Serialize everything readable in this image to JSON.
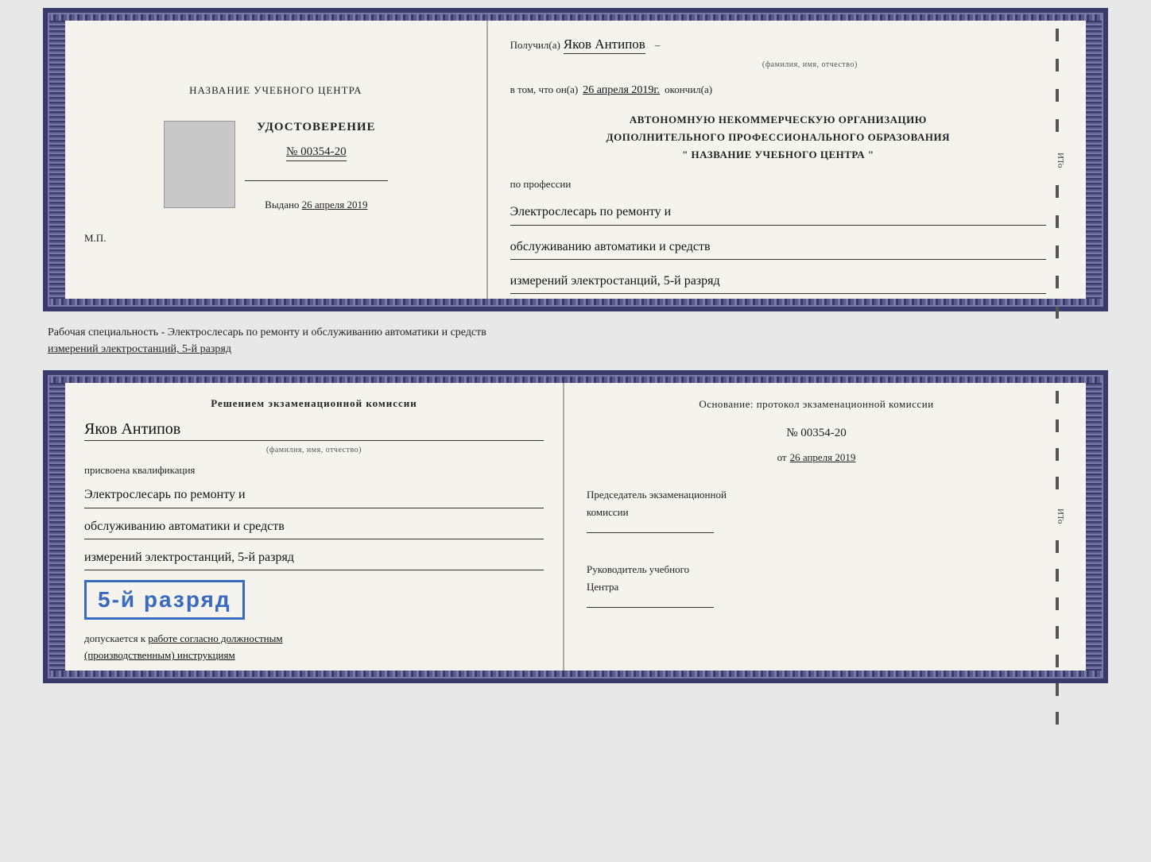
{
  "doc_top": {
    "left": {
      "center_title": "НАЗВАНИЕ УЧЕБНОГО ЦЕНТРА",
      "photo_alt": "Место для фото",
      "cert_title": "УДОСТОВЕРЕНИЕ",
      "cert_number": "№ 00354-20",
      "issued_label": "Выдано",
      "issued_date": "26 апреля 2019",
      "mp_label": "М.П."
    },
    "right": {
      "received_label": "Получил(а)",
      "person_name": "Яков Антипов",
      "fio_subtext": "(фамилия, имя, отчество)",
      "in_that_label": "в том, что он(а)",
      "completed_date": "26 апреля 2019г.",
      "completed_label": "окончил(а)",
      "org_line1": "АВТОНОМНУЮ НЕКОММЕРЧЕСКУЮ ОРГАНИЗАЦИЮ",
      "org_line2": "ДОПОЛНИТЕЛЬНОГО ПРОФЕССИОНАЛЬНОГО ОБРАЗОВАНИЯ",
      "org_line3": "\"  НАЗВАНИЕ УЧЕБНОГО ЦЕНТРА  \"",
      "profession_label": "по профессии",
      "profession_line1": "Электрослесарь по ремонту и",
      "profession_line2": "обслуживанию автоматики и средств",
      "profession_line3": "измерений электростанций, 5-й разряд",
      "ito_mark": "ИТо"
    }
  },
  "middle": {
    "text_line1": "Рабочая специальность - Электрослесарь по ремонту и обслуживанию автоматики и средств",
    "text_line2": "измерений электростанций, 5-й разряд"
  },
  "doc_bottom": {
    "left": {
      "decision_text": "Решением экзаменационной комиссии",
      "person_name": "Яков Антипов",
      "fio_subtext": "(фамилия, имя, отчество)",
      "qualification_label": "присвоена квалификация",
      "qualification_line1": "Электрослесарь по ремонту и",
      "qualification_line2": "обслуживанию автоматики и средств",
      "qualification_line3": "измерений электростанций, 5-й разряд",
      "rank_badge_text": "5-й разряд",
      "allowed_label": "допускается к",
      "allowed_handwritten": "работе согласно должностным",
      "instructions_handwritten": "(производственным) инструкциям"
    },
    "right": {
      "basis_label": "Основание: протокол экзаменационной комиссии",
      "doc_number": "№  00354-20",
      "date_prefix": "от",
      "date_value": "26 апреля 2019",
      "chair_title_line1": "Председатель экзаменационной",
      "chair_title_line2": "комиссии",
      "leader_title_line1": "Руководитель учебного",
      "leader_title_line2": "Центра",
      "ito_mark": "ИТо"
    }
  }
}
